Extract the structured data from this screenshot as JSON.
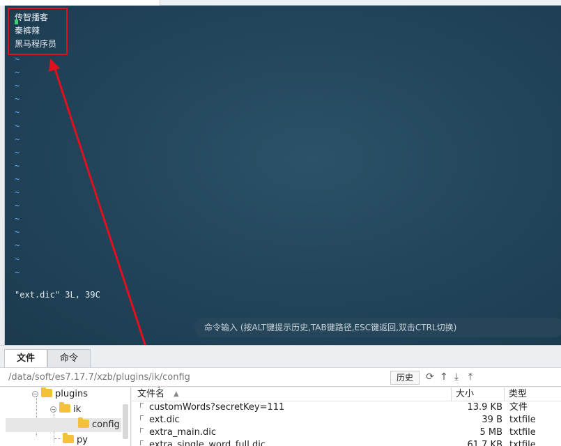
{
  "terminal": {
    "lines": [
      "传智播客",
      "秦裤辣",
      "黑马程序员"
    ],
    "tilde": "~",
    "status": "\"ext.dic\" 3L, 39C",
    "command_placeholder": "命令输入 (按ALT键提示历史,TAB键路径,ESC键返回,双击CTRL切换)"
  },
  "tabs": [
    {
      "label": "文件",
      "active": true
    },
    {
      "label": "命令",
      "active": false
    }
  ],
  "path": {
    "value": "/data/soft/es7.17.7/xzb/plugins/ik/config",
    "history_label": "历史"
  },
  "tree": {
    "items": [
      {
        "label": "plugins",
        "level": 1
      },
      {
        "label": "ik",
        "level": 2
      },
      {
        "label": "config",
        "level": 3,
        "selected": true
      },
      {
        "label": "py",
        "level": 2
      }
    ]
  },
  "filelist": {
    "headers": {
      "name": "文件名",
      "size": "大小",
      "type": "类型"
    },
    "rows": [
      {
        "name": "customWords?secretKey=111",
        "size": "13.9 KB",
        "type": "文件"
      },
      {
        "name": "ext.dic",
        "size": "39 B",
        "type": "txtfile"
      },
      {
        "name": "extra_main.dic",
        "size": "5 MB",
        "type": "txtfile"
      },
      {
        "name": "extra_single_word_full.dic",
        "size": "61.7 KB",
        "type": "txtfile"
      }
    ]
  },
  "colors": {
    "annotation": "#e0101e",
    "terminal_bg": "#23465c"
  }
}
